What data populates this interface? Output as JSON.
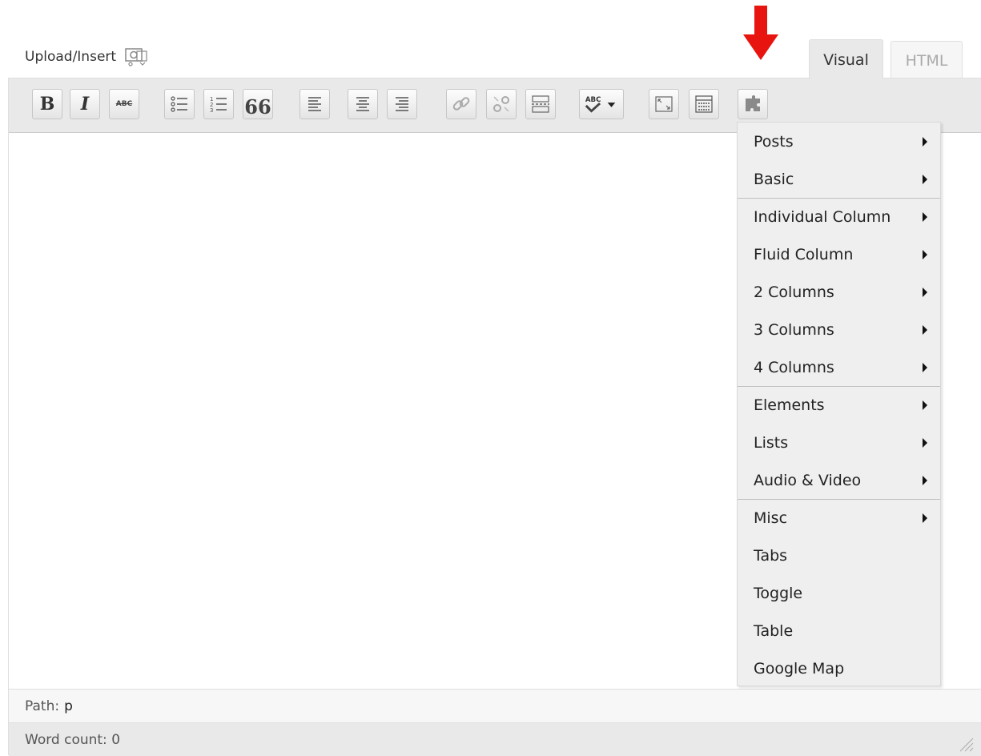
{
  "upload": {
    "label": "Upload/Insert"
  },
  "tabs": {
    "visual": "Visual",
    "html": "HTML"
  },
  "toolbar": {
    "bold_label": "B",
    "italic_label": "I",
    "strike_label": "ABC",
    "blockquote_label": "66",
    "spellcheck_label": "ABC"
  },
  "status": {
    "path_label": "Path:",
    "path_value": "p",
    "word_count_label": "Word count: 0"
  },
  "menu": {
    "items": [
      {
        "label": "Posts",
        "has_submenu": true
      },
      {
        "label": "Basic",
        "has_submenu": true
      },
      {
        "label": "Individual Column",
        "has_submenu": true
      },
      {
        "label": "Fluid Column",
        "has_submenu": true
      },
      {
        "label": "2 Columns",
        "has_submenu": true
      },
      {
        "label": "3 Columns",
        "has_submenu": true
      },
      {
        "label": "4 Columns",
        "has_submenu": true
      },
      {
        "label": "Elements",
        "has_submenu": true
      },
      {
        "label": "Lists",
        "has_submenu": true
      },
      {
        "label": "Audio & Video",
        "has_submenu": true
      },
      {
        "label": "Misc",
        "has_submenu": true
      },
      {
        "label": "Tabs",
        "has_submenu": false
      },
      {
        "label": "Toggle",
        "has_submenu": false
      },
      {
        "label": "Table",
        "has_submenu": false
      },
      {
        "label": "Google Map",
        "has_submenu": false
      }
    ]
  },
  "colors": {
    "toolbar_bg": "#e9e9e9",
    "menu_bg": "#efefef",
    "arrow_indicator": "#e8140f"
  }
}
